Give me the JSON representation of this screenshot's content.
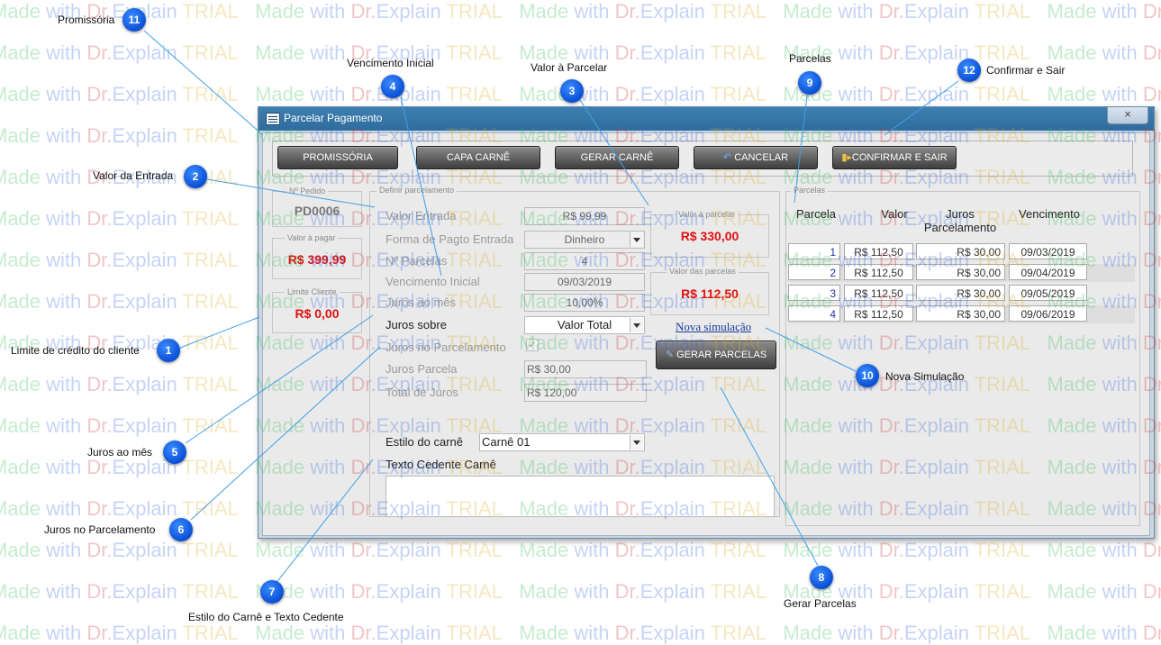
{
  "window": {
    "title": "Parcelar Pagamento",
    "close": "×"
  },
  "toolbar": {
    "promissoria": "PROMISSÓRIA",
    "capa": "CAPA CARNÊ",
    "gerar_carne": "GERAR CARNÊ",
    "cancelar": "CANCELAR",
    "confirmar": "CONFIRMAR E SAIR"
  },
  "left": {
    "pedido_legend": "Nº Pedido",
    "pedido_value": "PD0006",
    "valor_legend": "Valor à pagar",
    "valor_value": "R$ 399,99",
    "limite_legend": "Limite Cliente",
    "limite_value": "R$ 0,00"
  },
  "definir": {
    "legend": "Definir parcelamento",
    "valor_entrada_label": "Valor Entrada",
    "valor_entrada": "R$ 99,99",
    "forma_label": "Forma de Pagto Entrada",
    "forma": "Dinheiro",
    "nparcelas_label": "Nº Parcelas",
    "nparcelas": "4",
    "vencimento_label": "Vencimento Inicial",
    "vencimento": "09/03/2019",
    "juros_mes_label": "Juros ao mês",
    "juros_mes": "10,00%",
    "juros_sobre_label": "Juros sobre",
    "juros_sobre": "Valor Total",
    "juros_parc_label": "Juros no Parcelamento",
    "juros_parc_check": "✓",
    "juros_parcela_label": "Juros Parcela",
    "juros_parcela": "R$ 30,00",
    "total_juros_label": "Total de Juros",
    "total_juros": "R$ 120,00",
    "valor_a_parcelar_legend": "Valor à parcelar",
    "valor_a_parcelar": "R$ 330,00",
    "valor_parcelas_legend": "Valor das parcelas",
    "valor_parcelas": "R$ 112,50",
    "nova_simulacao": "Nova simulação",
    "gerar_parcelas": "GERAR PARCELAS",
    "estilo_label": "Estilo do carnê",
    "estilo": "Carnê 01",
    "texto_label": "Texto Cedente Carnê"
  },
  "parcelas": {
    "legend": "Parcelas",
    "headers": [
      "Parcela",
      "Valor",
      "Juros Parcelamento",
      "Vencimento"
    ],
    "rows": [
      {
        "n": "1",
        "valor": "R$ 112,50",
        "juros": "R$ 30,00",
        "venc": "09/03/2019"
      },
      {
        "n": "2",
        "valor": "R$ 112,50",
        "juros": "R$ 30,00",
        "venc": "09/04/2019"
      },
      {
        "n": "3",
        "valor": "R$ 112,50",
        "juros": "R$ 30,00",
        "venc": "09/05/2019"
      },
      {
        "n": "4",
        "valor": "R$ 112,50",
        "juros": "R$ 30,00",
        "venc": "09/06/2019"
      }
    ]
  },
  "callouts": {
    "c1": {
      "num": "1",
      "text": "Limite de crédito do cliente"
    },
    "c2": {
      "num": "2",
      "text": "Valor da Entrada"
    },
    "c3": {
      "num": "3",
      "text": "Valor à Parcelar"
    },
    "c4": {
      "num": "4",
      "text": "Vencimento Inicial"
    },
    "c5": {
      "num": "5",
      "text": "Juros ao mês"
    },
    "c6": {
      "num": "6",
      "text": "Juros no Parcelamento"
    },
    "c7": {
      "num": "7",
      "text": "Estilo do Carnê e Texto Cedente"
    },
    "c8": {
      "num": "8",
      "text": "Gerar Parcelas"
    },
    "c9": {
      "num": "9",
      "text": "Parcelas"
    },
    "c10": {
      "num": "10",
      "text": "Nova Simulação"
    },
    "c11": {
      "num": "11",
      "text": "Promissória"
    },
    "c12": {
      "num": "12",
      "text": "Confirmar e Sair"
    }
  },
  "watermark": {
    "made": "Made ",
    "with": "with ",
    "dr": "Dr.",
    "explain": "Explain ",
    "trial": "TRIAL"
  }
}
